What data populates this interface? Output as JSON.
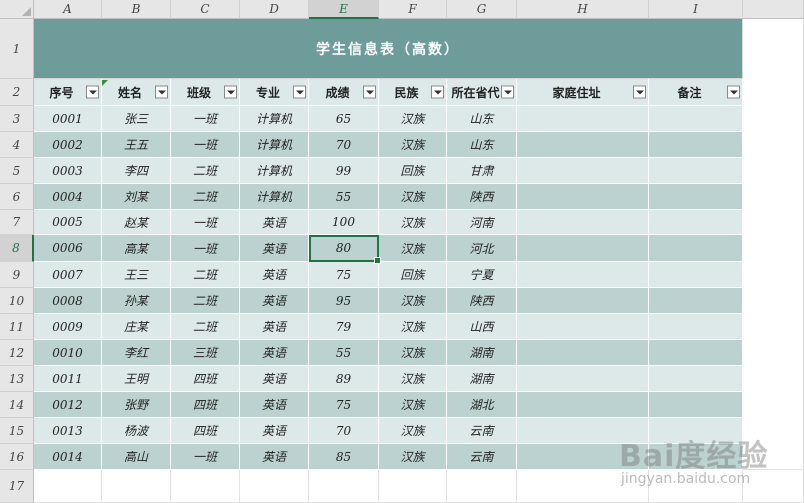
{
  "columns": [
    "A",
    "B",
    "C",
    "D",
    "E",
    "F",
    "G",
    "H",
    "I"
  ],
  "selected_column": "E",
  "rows": [
    "1",
    "2",
    "3",
    "4",
    "5",
    "6",
    "7",
    "8",
    "9",
    "10",
    "11",
    "12",
    "13",
    "14",
    "15",
    "16",
    "17"
  ],
  "selected_row": "8",
  "title": "学生信息表（高数）",
  "headers": [
    "序号",
    "姓名",
    "班级",
    "专业",
    "成绩",
    "民族",
    "所在省份",
    "家庭住址",
    "备注"
  ],
  "headers_visible": [
    "序号",
    "姓名",
    "班级",
    "专业",
    "成绩",
    "民族",
    "所在省代",
    "家庭住址",
    "备注"
  ],
  "table": [
    [
      "0001",
      "张三",
      "一班",
      "计算机",
      "65",
      "汉族",
      "山东",
      "",
      ""
    ],
    [
      "0002",
      "王五",
      "一班",
      "计算机",
      "70",
      "汉族",
      "山东",
      "",
      ""
    ],
    [
      "0003",
      "李四",
      "二班",
      "计算机",
      "99",
      "回族",
      "甘肃",
      "",
      ""
    ],
    [
      "0004",
      "刘某",
      "二班",
      "计算机",
      "55",
      "汉族",
      "陕西",
      "",
      ""
    ],
    [
      "0005",
      "赵某",
      "一班",
      "英语",
      "100",
      "汉族",
      "河南",
      "",
      ""
    ],
    [
      "0006",
      "高某",
      "一班",
      "英语",
      "80",
      "汉族",
      "河北",
      "",
      ""
    ],
    [
      "0007",
      "王三",
      "二班",
      "英语",
      "75",
      "回族",
      "宁夏",
      "",
      ""
    ],
    [
      "0008",
      "孙某",
      "二班",
      "英语",
      "95",
      "汉族",
      "陕西",
      "",
      ""
    ],
    [
      "0009",
      "庄某",
      "二班",
      "英语",
      "79",
      "汉族",
      "山西",
      "",
      ""
    ],
    [
      "0010",
      "李红",
      "三班",
      "英语",
      "55",
      "汉族",
      "湖南",
      "",
      ""
    ],
    [
      "0011",
      "王明",
      "四班",
      "英语",
      "89",
      "汉族",
      "湖南",
      "",
      ""
    ],
    [
      "0012",
      "张野",
      "四班",
      "英语",
      "75",
      "汉族",
      "湖北",
      "",
      ""
    ],
    [
      "0013",
      "杨波",
      "四班",
      "英语",
      "70",
      "汉族",
      "云南",
      "",
      ""
    ],
    [
      "0014",
      "高山",
      "一班",
      "英语",
      "85",
      "汉族",
      "云南",
      "",
      ""
    ]
  ],
  "watermark": {
    "logo": "Bai度经验",
    "url": "jingyan.baidu.com"
  },
  "colors": {
    "title_bg": "#6e9c9a",
    "band_light": "#dde9e9",
    "band_dark": "#bcd2d0",
    "selection": "#217346"
  }
}
